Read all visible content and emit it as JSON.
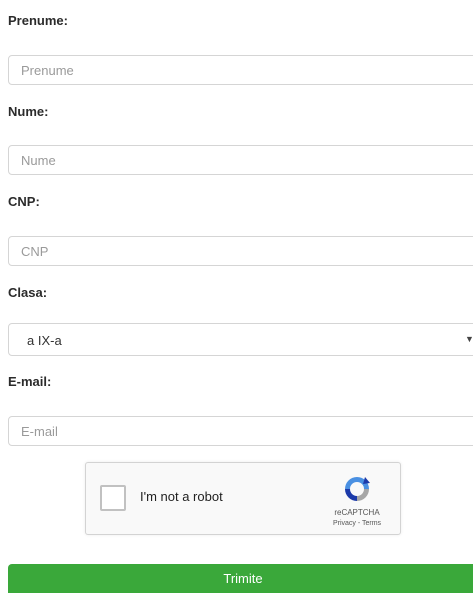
{
  "form": {
    "fields": [
      {
        "label": "Prenume:",
        "placeholder": "Prenume"
      },
      {
        "label": "Nume:",
        "placeholder": "Nume"
      },
      {
        "label": "CNP:",
        "placeholder": "CNP"
      },
      {
        "label": "Clasa:",
        "selected": "a IX-a"
      },
      {
        "label": "E-mail:",
        "placeholder": "E-mail"
      }
    ],
    "recaptcha": {
      "label": "I'm not a robot",
      "brand": "reCAPTCHA",
      "links": "Privacy - Terms",
      "icon": "recaptcha-logo-icon"
    },
    "submit_label": "Trimite"
  },
  "colors": {
    "submit_bg": "#3aa83a",
    "recaptcha_blue": "#4a90e2",
    "recaptcha_dark_blue": "#1c3aa9",
    "recaptcha_gray": "#a6a6a6"
  }
}
